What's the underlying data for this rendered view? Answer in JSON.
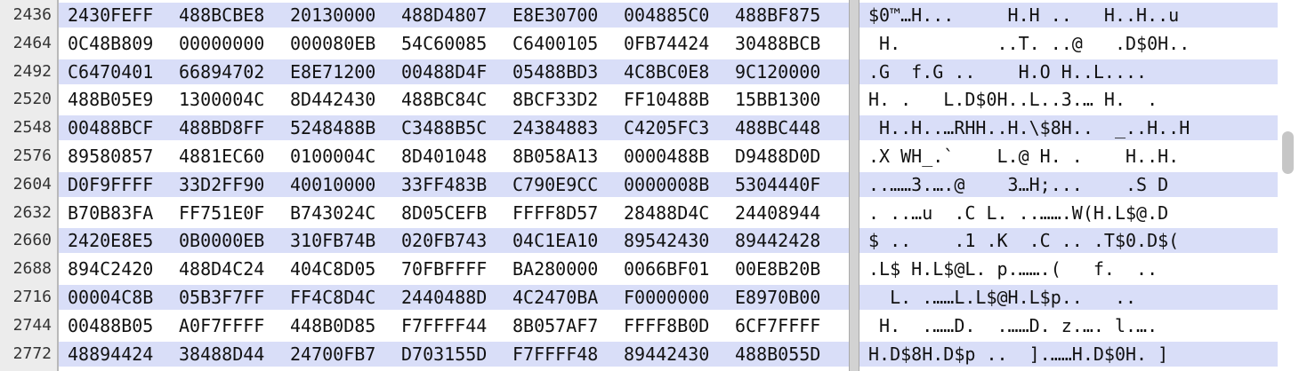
{
  "hex_editor": {
    "rows": [
      {
        "offset": "2436",
        "words": [
          "2430FEFF",
          "488BCBE8",
          "20130000",
          "488D4807",
          "E8E30700",
          "004885C0",
          "488BF875"
        ],
        "text": "$0™…H...     H.H ..   H..H..u"
      },
      {
        "offset": "2464",
        "words": [
          "0C48B809",
          "00000000",
          "000080EB",
          "54C60085",
          "C6400105",
          "0FB74424",
          "30488BCB"
        ],
        "text": " H.         ..T. ..@   .D$0H.."
      },
      {
        "offset": "2492",
        "words": [
          "C6470401",
          "66894702",
          "E8E71200",
          "00488D4F",
          "05488BD3",
          "4C8BC0E8",
          "9C120000"
        ],
        "text": ".G  f.G ..    H.O H..L...."
      },
      {
        "offset": "2520",
        "words": [
          "488B05E9",
          "1300004C",
          "8D442430",
          "488BC84C",
          "8BCF33D2",
          "FF10488B",
          "15BB1300"
        ],
        "text": "H. .   L.D$0H..L..3.… H.  ."
      },
      {
        "offset": "2548",
        "words": [
          "00488BCF",
          "488BD8FF",
          "5248488B",
          "C3488B5C",
          "24384883",
          "C4205FC3",
          "488BC448"
        ],
        "text": " H..H..…RHH..H.\\$8H..  _..H..H"
      },
      {
        "offset": "2576",
        "words": [
          "89580857",
          "4881EC60",
          "0100004C",
          "8D401048",
          "8B058A13",
          "0000488B",
          "D9488D0D"
        ],
        "text": ".X WH_.`    L.@ H. .    H..H."
      },
      {
        "offset": "2604",
        "words": [
          "D0F9FFFF",
          "33D2FF90",
          "40010000",
          "33FF483B",
          "C790E9CC",
          "0000008B",
          "5304440F"
        ],
        "text": "..……3.….@    3…H;...    .S D"
      },
      {
        "offset": "2632",
        "words": [
          "B70B83FA",
          "FF751E0F",
          "B743024C",
          "8D05CEFB",
          "FFFF8D57",
          "28488D4C",
          "24408944"
        ],
        "text": ". ..…u  .C L. ..…….W(H.L$@.D"
      },
      {
        "offset": "2660",
        "words": [
          "2420E8E5",
          "0B0000EB",
          "310FB74B",
          "020FB743",
          "04C1EA10",
          "89542430",
          "89442428"
        ],
        "text": "$ ..    .1 .K  .C .. .T$0.D$("
      },
      {
        "offset": "2688",
        "words": [
          "894C2420",
          "488D4C24",
          "404C8D05",
          "70FBFFFF",
          "BA280000",
          "0066BF01",
          "00E8B20B"
        ],
        "text": ".L$ H.L$@L. p.…….(   f.  .."
      },
      {
        "offset": "2716",
        "words": [
          "00004C8B",
          "05B3F7FF",
          "FF4C8D4C",
          "2440488D",
          "4C2470BA",
          "F0000000",
          "E8970B00"
        ],
        "text": "  L. .……L.L$@H.L$p..   .."
      },
      {
        "offset": "2744",
        "words": [
          "00488B05",
          "A0F7FFFF",
          "448B0D85",
          "F7FFFF44",
          "8B057AF7",
          "FFFF8B0D",
          "6CF7FFFF"
        ],
        "text": " H.  .……D.  .……D. z.…. l.…."
      },
      {
        "offset": "2772",
        "words": [
          "48894424",
          "38488D44",
          "24700FB7",
          "D703155D",
          "F7FFFF48",
          "89442430",
          "488B055D"
        ],
        "text": "H.D$8H.D$p ..  ].……H.D$0H. ]"
      }
    ]
  }
}
